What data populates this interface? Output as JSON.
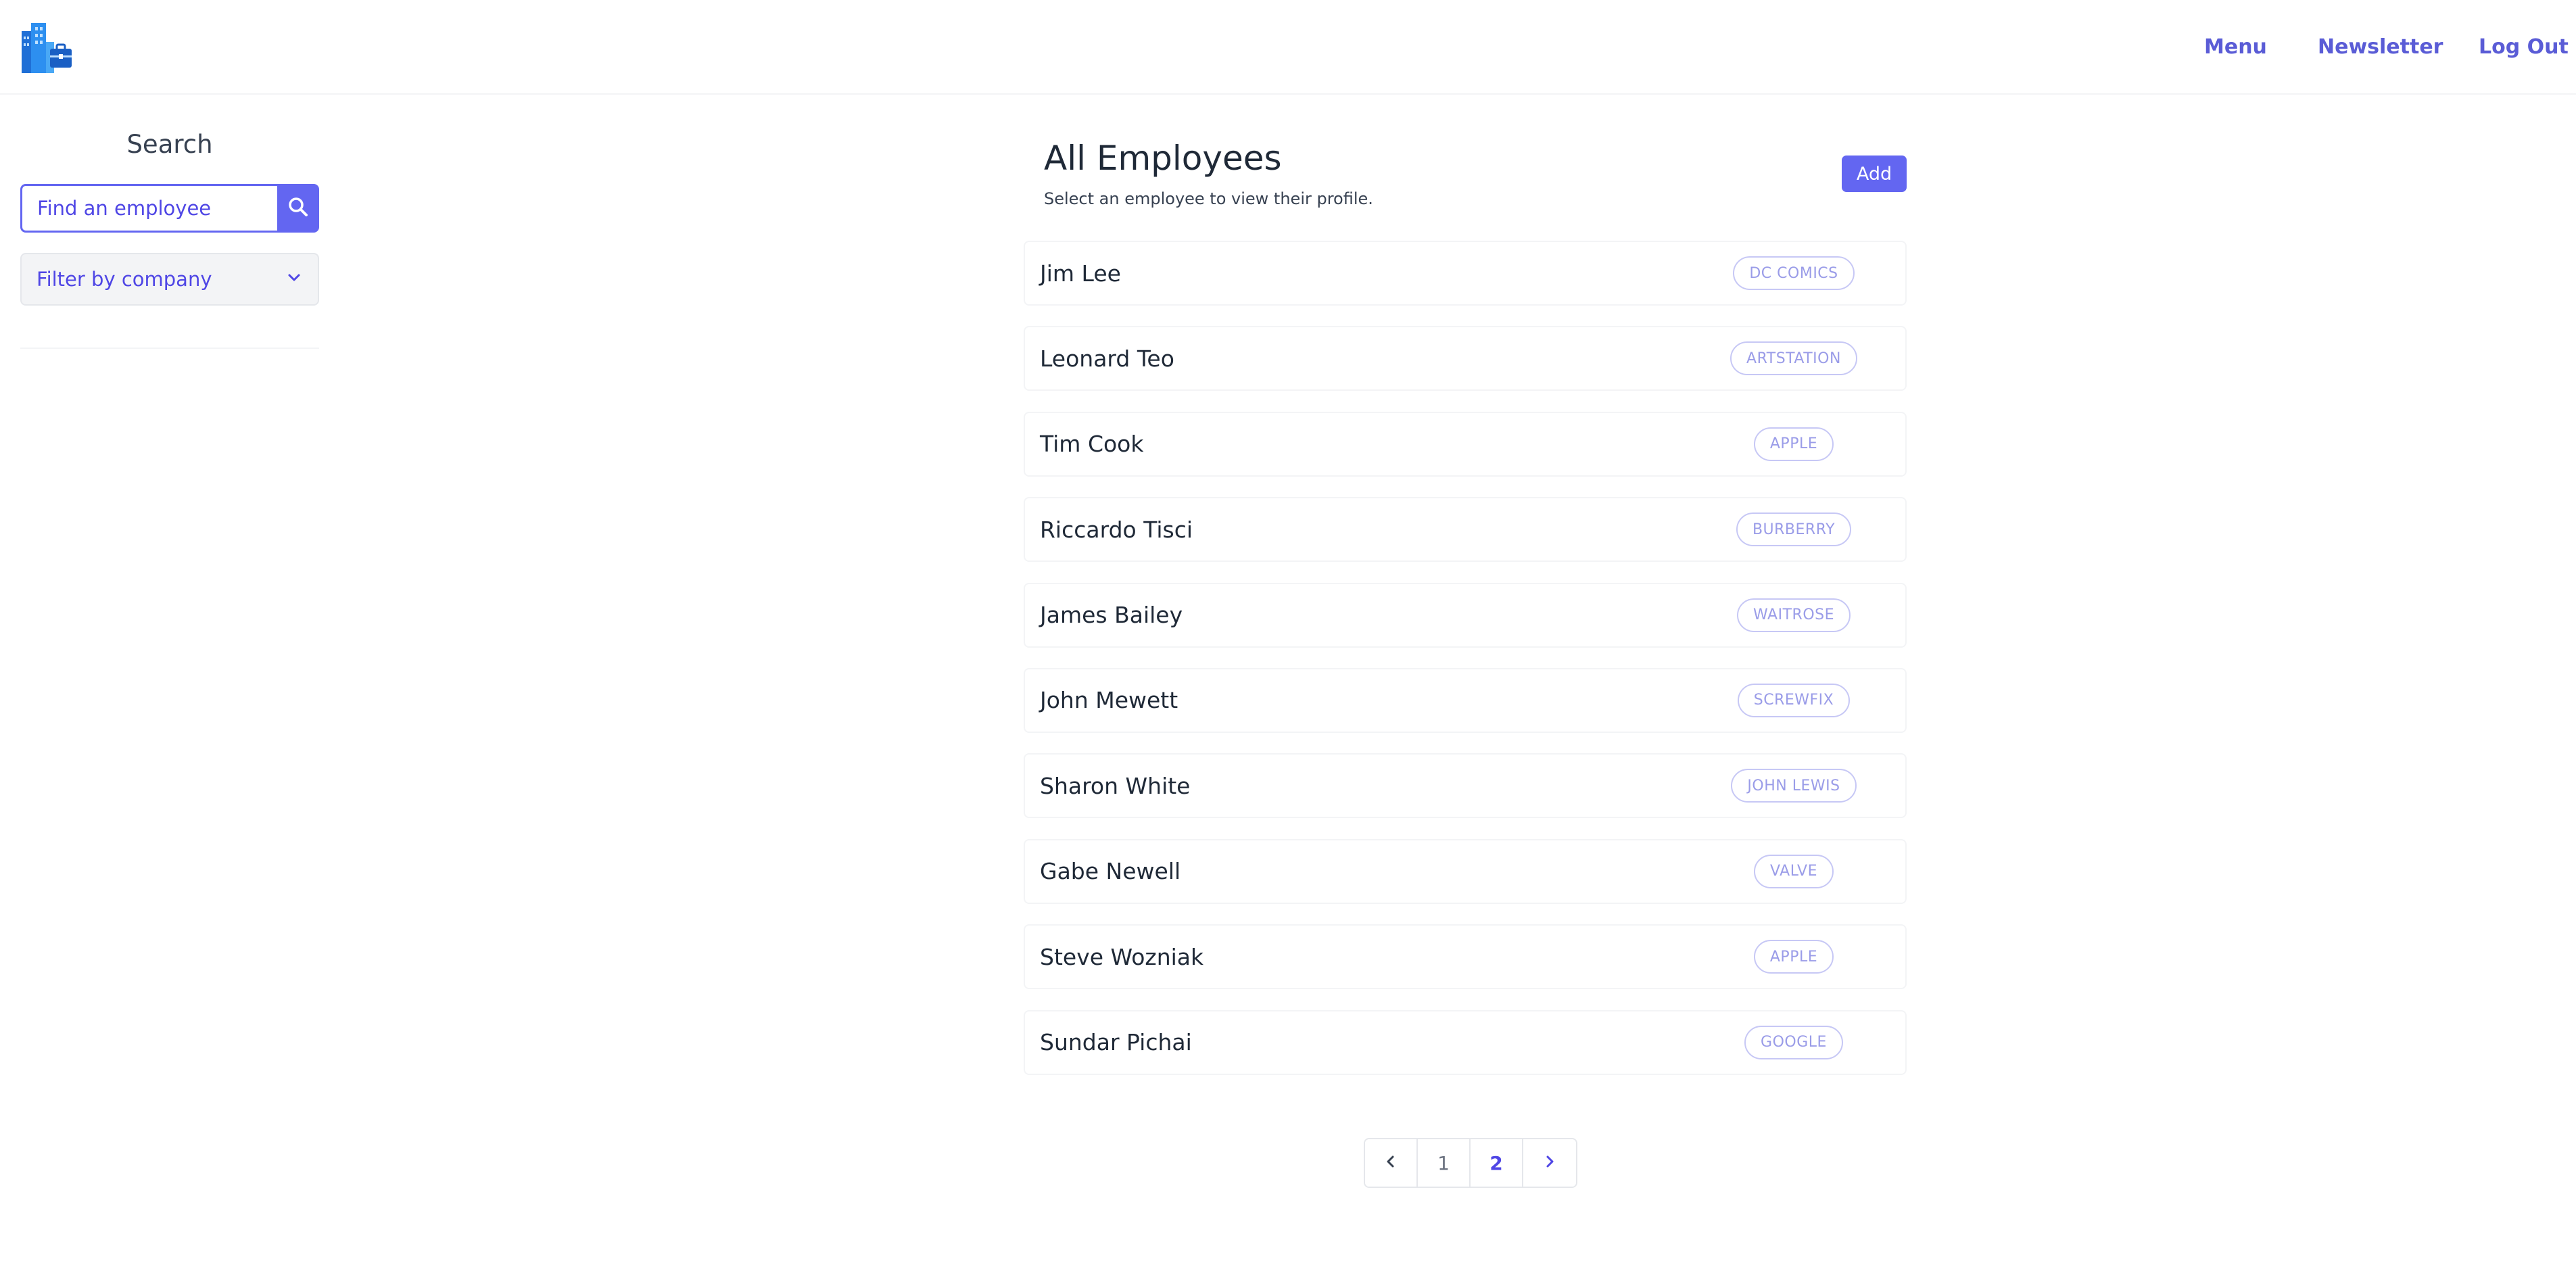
{
  "header": {
    "logo_icon": "office-building-briefcase-icon",
    "nav": [
      "Menu",
      "Newsletter",
      "Log Out"
    ]
  },
  "sidebar": {
    "title": "Search",
    "search_placeholder": "Find an employee",
    "search_icon": "search-icon",
    "filter_label": "Filter by company",
    "filter_icon": "chevron-down-icon"
  },
  "main": {
    "title": "All Employees",
    "subtitle": "Select an employee to view their profile.",
    "add_label": "Add",
    "employees": [
      {
        "name": "Jim Lee",
        "company": "DC COMICS"
      },
      {
        "name": "Leonard Teo",
        "company": "ARTSTATION"
      },
      {
        "name": "Tim Cook",
        "company": "APPLE"
      },
      {
        "name": "Riccardo Tisci",
        "company": "BURBERRY"
      },
      {
        "name": "James Bailey",
        "company": "WAITROSE"
      },
      {
        "name": "John Mewett",
        "company": "SCREWFIX"
      },
      {
        "name": "Sharon White",
        "company": "JOHN LEWIS"
      },
      {
        "name": "Gabe Newell",
        "company": "VALVE"
      },
      {
        "name": "Steve Wozniak",
        "company": "APPLE"
      },
      {
        "name": "Sundar Pichai",
        "company": "GOOGLE"
      }
    ]
  },
  "pagination": {
    "prev_icon": "chevron-left-icon",
    "pages": [
      "1",
      "2"
    ],
    "current_page": "2",
    "next_icon": "chevron-right-icon"
  },
  "colors": {
    "accent": "#6366f1",
    "accent_text": "#4f46e5",
    "badge_border": "#c7c8f5",
    "badge_text": "#9a9ce8"
  }
}
